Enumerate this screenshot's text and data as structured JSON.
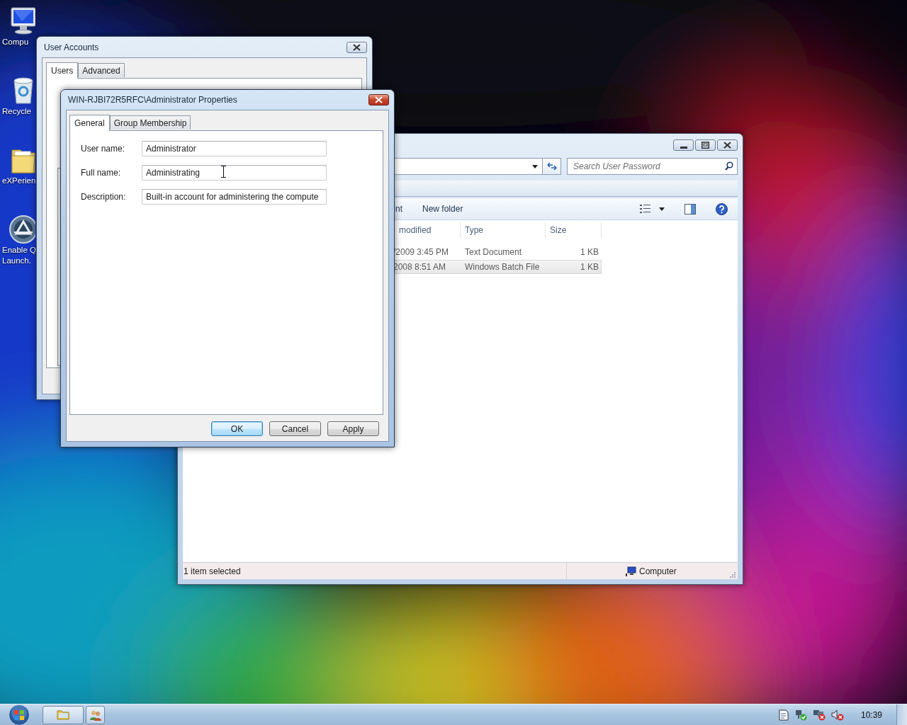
{
  "desktop_icons": [
    {
      "kind": "computer",
      "lines": [
        "Compu"
      ]
    },
    {
      "kind": "recycle-bin",
      "lines": [
        "Recycle"
      ]
    },
    {
      "kind": "folder",
      "lines": [
        "eXPerien"
      ]
    },
    {
      "kind": "launcher",
      "lines": [
        "Enable Q",
        "Launch."
      ]
    }
  ],
  "user_accounts_window": {
    "title": "User Accounts",
    "active": false,
    "tabs": [
      {
        "label": "Users",
        "selected": true
      },
      {
        "label": "Advanced",
        "selected": false
      }
    ]
  },
  "explorer_window": {
    "active": false,
    "search": {
      "placeholder": "Search User Password"
    },
    "toolbar": [
      "nt",
      "New folder"
    ],
    "columns": [
      "modified",
      "Type",
      "Size"
    ],
    "rows": [
      {
        "cells": [
          "/2009 3:45 PM",
          "Text Document",
          "1 KB"
        ],
        "selected": false
      },
      {
        "cells": [
          "2008 8:51 AM",
          "Windows Batch File",
          "1 KB"
        ],
        "selected": true
      }
    ],
    "status_bar": {
      "text": "1 item selected",
      "location": "Computer"
    }
  },
  "properties_dialog": {
    "title": "WIN-RJBI72R5RFC\\Administrator Properties",
    "active": true,
    "tabs": [
      {
        "label": "General",
        "selected": true
      },
      {
        "label": "Group Membership",
        "selected": false
      }
    ],
    "fields": [
      {
        "label": "User name:",
        "value": "Administrator"
      },
      {
        "label": "Full name:",
        "value": "Administrating"
      },
      {
        "label": "Description:",
        "value": "Built-in account for administering the compute"
      }
    ],
    "buttons": [
      {
        "label": "OK",
        "default": true
      },
      {
        "label": "Cancel",
        "default": false
      },
      {
        "label": "Apply",
        "default": false
      }
    ]
  },
  "taskbar": {
    "clock": "10:39"
  }
}
